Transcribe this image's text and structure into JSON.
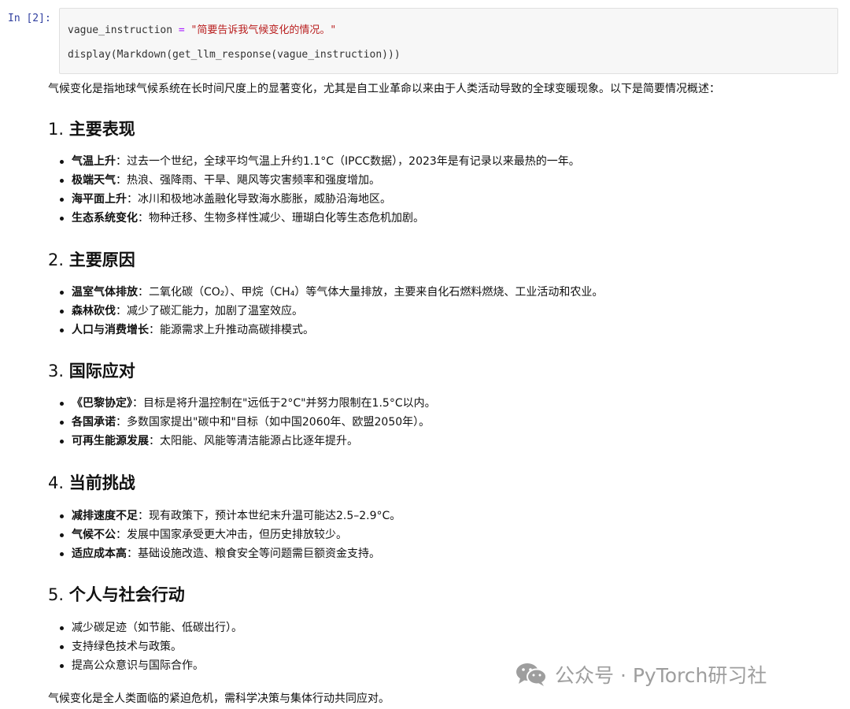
{
  "cell": {
    "prompt": "In [2]:",
    "line1_var": "vague_instruction",
    "line1_op": " = ",
    "line1_str": "\"简要告诉我气候变化的情况。\"",
    "line2": "display(Markdown(get_llm_response(vague_instruction)))"
  },
  "output": {
    "intro": "气候变化是指地球气候系统在长时间尺度上的显著变化，尤其是自工业革命以来由于人类活动导致的全球变暖现象。以下是简要情况概述：",
    "sections": [
      {
        "num": "1.",
        "title": "主要表现",
        "items": [
          {
            "bold": "气温上升",
            "text": "：过去一个世纪，全球平均气温上升约1.1°C（IPCC数据），2023年是有记录以来最热的一年。"
          },
          {
            "bold": "极端天气",
            "text": "：热浪、强降雨、干旱、飓风等灾害频率和强度增加。"
          },
          {
            "bold": "海平面上升",
            "text": "：冰川和极地冰盖融化导致海水膨胀，威胁沿海地区。"
          },
          {
            "bold": "生态系统变化",
            "text": "：物种迁移、生物多样性减少、珊瑚白化等生态危机加剧。"
          }
        ]
      },
      {
        "num": "2.",
        "title": "主要原因",
        "items": [
          {
            "bold": "温室气体排放",
            "text": "：二氧化碳（CO₂）、甲烷（CH₄）等气体大量排放，主要来自化石燃料燃烧、工业活动和农业。"
          },
          {
            "bold": "森林砍伐",
            "text": "：减少了碳汇能力，加剧了温室效应。"
          },
          {
            "bold": "人口与消费增长",
            "text": "：能源需求上升推动高碳排模式。"
          }
        ]
      },
      {
        "num": "3.",
        "title": "国际应对",
        "items": [
          {
            "bold": "《巴黎协定》",
            "text": "：目标是将升温控制在\"远低于2°C\"并努力限制在1.5°C以内。"
          },
          {
            "bold": "各国承诺",
            "text": "：多数国家提出\"碳中和\"目标（如中国2060年、欧盟2050年）。"
          },
          {
            "bold": "可再生能源发展",
            "text": "：太阳能、风能等清洁能源占比逐年提升。"
          }
        ]
      },
      {
        "num": "4.",
        "title": "当前挑战",
        "items": [
          {
            "bold": "减排速度不足",
            "text": "：现有政策下，预计本世纪末升温可能达2.5–2.9°C。"
          },
          {
            "bold": "气候不公",
            "text": "：发展中国家承受更大冲击，但历史排放较少。"
          },
          {
            "bold": "适应成本高",
            "text": "：基础设施改造、粮食安全等问题需巨额资金支持。"
          }
        ]
      },
      {
        "num": "5.",
        "title": "个人与社会行动",
        "items": [
          {
            "bold": "",
            "text": "减少碳足迹（如节能、低碳出行）。"
          },
          {
            "bold": "",
            "text": "支持绿色技术与政策。"
          },
          {
            "bold": "",
            "text": "提高公众意识与国际合作。"
          }
        ]
      }
    ],
    "outro": "气候变化是全人类面临的紧迫危机，需科学决策与集体行动共同应对。"
  },
  "watermark": {
    "text": "公众号 · PyTorch研习社",
    "icon": "wechat-icon"
  }
}
